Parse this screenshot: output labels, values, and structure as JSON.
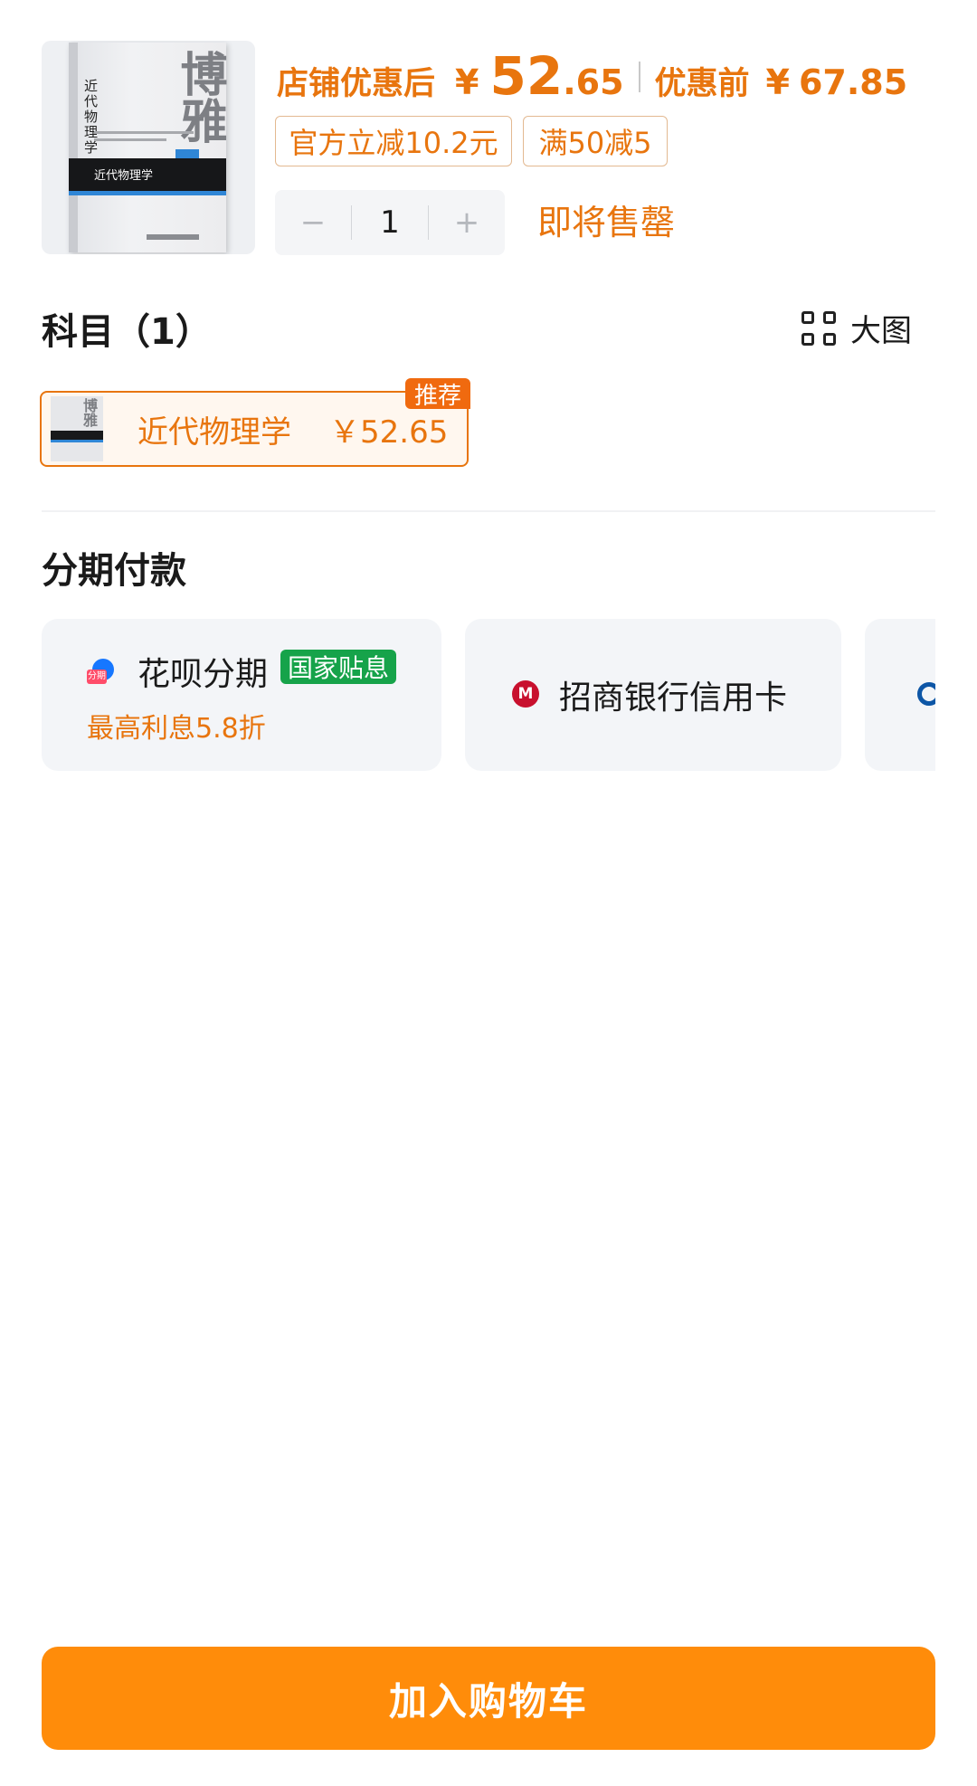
{
  "product": {
    "price_label": "店铺优惠后",
    "currency": "¥",
    "price_integer": "52",
    "price_decimal": ".65",
    "original_label": "优惠前",
    "original_currency": "¥",
    "original_price": "67.85",
    "tags": [
      "官方立减10.2元",
      "满50减5"
    ],
    "quantity": "1",
    "decrement_symbol": "−",
    "increment_symbol": "+",
    "stock_status": "即将售罄"
  },
  "subject": {
    "title": "科目（1）",
    "big_view_label": "大图",
    "option": {
      "label": "近代物理学",
      "price": "￥52.65",
      "badge": "推荐"
    }
  },
  "installment": {
    "title": "分期付款",
    "cards": [
      {
        "name": "花呗分期",
        "badge": "国家贴息",
        "subtitle": "最高利息5.8折",
        "icon": "huabei-icon"
      },
      {
        "name": "招商银行信用卡",
        "icon": "cmb-bank-icon"
      },
      {
        "name": "",
        "icon": "bank-icon"
      }
    ]
  },
  "cart": {
    "add_label": "加入购物车"
  },
  "colors": {
    "accent": "#e8750e",
    "button": "#ff8c0a",
    "subsidy_green": "#16a34a"
  }
}
